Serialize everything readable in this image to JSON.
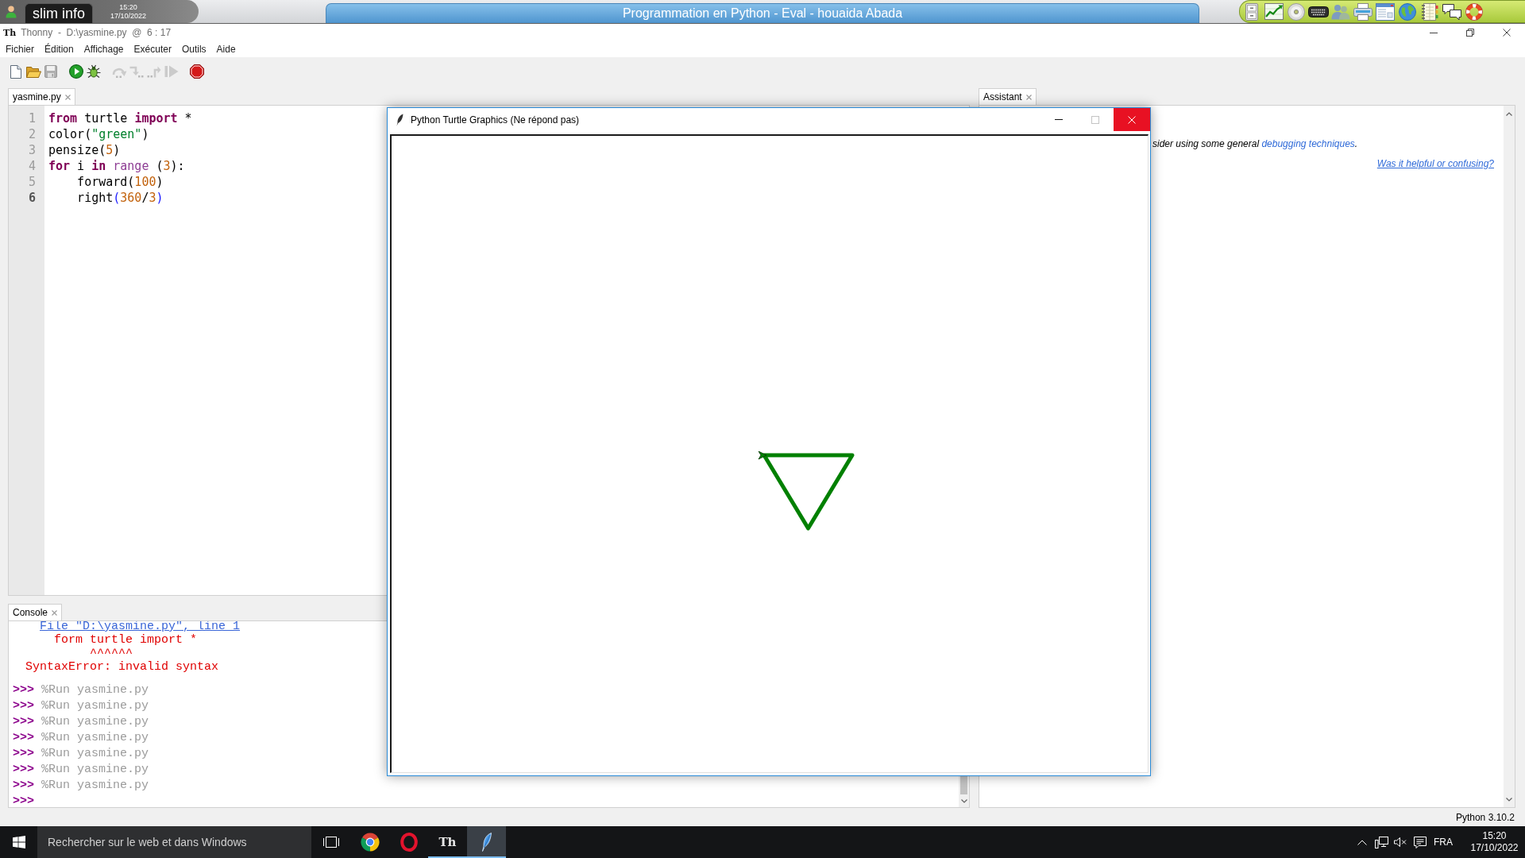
{
  "top_bar": {
    "app_tab": "slim info",
    "time": "15:20",
    "date": "17/10/2022",
    "window_tab": "Programmation en Python - Eval - houaida Abada"
  },
  "window": {
    "logo": "Th",
    "title": "Thonny  -  D:\\yasmine.py  @  6 : 17"
  },
  "menu": [
    "Fichier",
    "Édition",
    "Affichage",
    "Exécuter",
    "Outils",
    "Aide"
  ],
  "toolbar": [
    {
      "kind": "new",
      "disabled": false
    },
    {
      "kind": "open",
      "disabled": false
    },
    {
      "kind": "save",
      "disabled": true
    },
    {
      "kind": "run",
      "disabled": false
    },
    {
      "kind": "debug",
      "disabled": false
    },
    {
      "kind": "stepover",
      "disabled": true
    },
    {
      "kind": "stepinto",
      "disabled": true
    },
    {
      "kind": "stepout",
      "disabled": true
    },
    {
      "kind": "resume",
      "disabled": true
    },
    {
      "kind": "stop",
      "disabled": false
    }
  ],
  "editor": {
    "tabs": [
      {
        "label": "yasmine.py",
        "selected": true
      }
    ],
    "lines": [
      {
        "number": "1",
        "current": false,
        "tokens": [
          {
            "kind": "keyword",
            "text": "from"
          },
          {
            "kind": "plain",
            "text": " turtle "
          },
          {
            "kind": "keyword",
            "text": "import"
          },
          {
            "kind": "plain",
            "text": " *"
          }
        ]
      },
      {
        "number": "2",
        "current": false,
        "tokens": [
          {
            "kind": "plain",
            "text": "color("
          },
          {
            "kind": "string",
            "text": "\"green\""
          },
          {
            "kind": "plain",
            "text": ")"
          }
        ]
      },
      {
        "number": "3",
        "current": false,
        "tokens": [
          {
            "kind": "plain",
            "text": "pensize("
          },
          {
            "kind": "number",
            "text": "5"
          },
          {
            "kind": "plain",
            "text": ")"
          }
        ]
      },
      {
        "number": "4",
        "current": false,
        "tokens": [
          {
            "kind": "keyword",
            "text": "for"
          },
          {
            "kind": "plain",
            "text": " i "
          },
          {
            "kind": "keyword",
            "text": "in"
          },
          {
            "kind": "builtin",
            "text": " range"
          },
          {
            "kind": "plain",
            "text": " ("
          },
          {
            "kind": "number",
            "text": "3"
          },
          {
            "kind": "plain",
            "text": "):"
          }
        ],
        "children": [
          {
            "number": "5",
            "current": false,
            "tokens": [
              {
                "kind": "plain",
                "text": "forward("
              },
              {
                "kind": "number",
                "text": "100"
              },
              {
                "kind": "plain",
                "text": ")"
              }
            ]
          },
          {
            "number": "6",
            "current": true,
            "tokens": [
              {
                "kind": "plain",
                "text": "right"
              },
              {
                "kind": "bracket",
                "text": "("
              },
              {
                "kind": "number",
                "text": "360"
              },
              {
                "kind": "plain",
                "text": "/"
              },
              {
                "kind": "number",
                "text": "3"
              },
              {
                "kind": "bracket",
                "text": ")"
              }
            ]
          }
        ]
      }
    ]
  },
  "console": {
    "tabs": [
      {
        "label": "Console",
        "selected": true
      }
    ],
    "lines": [
      {
        "kind": "location",
        "text": "File \"D:\\yasmine.py\", line 1"
      },
      {
        "kind": "source",
        "text": "form turtle import *"
      },
      {
        "kind": "caret",
        "text": "^^^^^^"
      },
      {
        "kind": "error",
        "text": "SyntaxError: invalid syntax"
      },
      {
        "kind": "command",
        "prompt": ">>>",
        "text": "%Run yasmine.py"
      },
      {
        "kind": "command",
        "prompt": ">>>",
        "text": "%Run yasmine.py"
      },
      {
        "kind": "command",
        "prompt": ">>>",
        "text": "%Run yasmine.py"
      },
      {
        "kind": "command",
        "prompt": ">>>",
        "text": "%Run yasmine.py"
      },
      {
        "kind": "command",
        "prompt": ">>>",
        "text": "%Run yasmine.py"
      },
      {
        "kind": "command",
        "prompt": ">>>",
        "text": "%Run yasmine.py"
      },
      {
        "kind": "command",
        "prompt": ">>>",
        "text": "%Run yasmine.py"
      },
      {
        "kind": "prompt",
        "prompt": ">>>"
      }
    ]
  },
  "assistant": {
    "tabs": [
      {
        "label": "Assistant",
        "selected": true
      }
    ],
    "text": "sider using some general ",
    "link": "debugging techniques",
    "text_end": ".",
    "feedback": "Was it helpful or confusing?"
  },
  "turtle_window": {
    "title": "Python Turtle Graphics (Ne répond pas)",
    "buttons": [
      {
        "kind": "minimize",
        "disabled": false,
        "highlighted": false
      },
      {
        "kind": "maximize",
        "disabled": true,
        "highlighted": false
      },
      {
        "kind": "close",
        "disabled": false,
        "highlighted": true
      }
    ]
  },
  "status_bar": {
    "version": "Python 3.10.2"
  },
  "taskbar": {
    "search": {
      "placeholder": "Rechercher sur le web et dans Windows"
    },
    "apps": [
      {
        "kind": "chrome",
        "running": false,
        "active": false
      },
      {
        "kind": "opera",
        "running": false,
        "active": false
      },
      {
        "kind": "thonny",
        "label": "Th",
        "running": true,
        "active": false
      },
      {
        "kind": "turtle",
        "running": true,
        "active": true
      }
    ],
    "muted": true,
    "language": "FRA",
    "time": "15:20",
    "date": "17/10/2022"
  }
}
